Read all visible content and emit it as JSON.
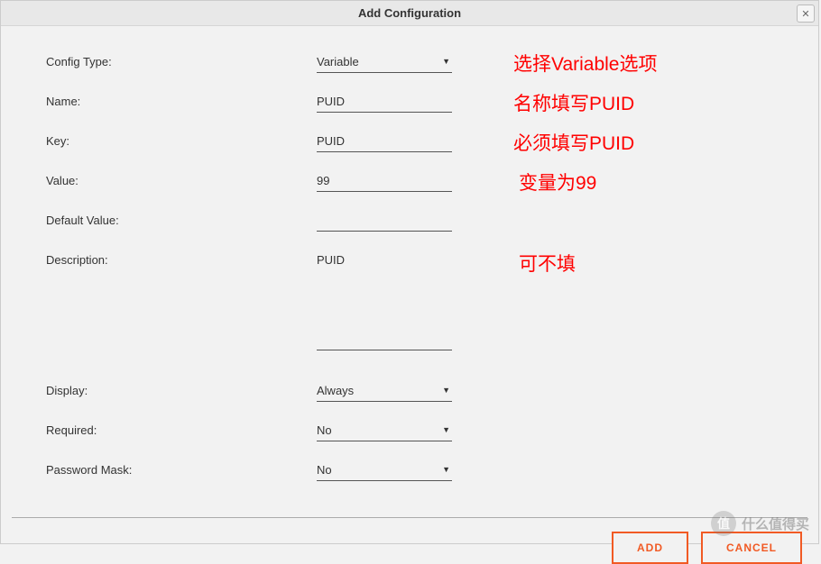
{
  "dialog": {
    "title": "Add Configuration",
    "close": "✕"
  },
  "form": {
    "configType": {
      "label": "Config Type:",
      "value": "Variable"
    },
    "name": {
      "label": "Name:",
      "value": "PUID"
    },
    "key": {
      "label": "Key:",
      "value": "PUID"
    },
    "value": {
      "label": "Value:",
      "value": "99"
    },
    "defaultValue": {
      "label": "Default Value:",
      "value": ""
    },
    "description": {
      "label": "Description:",
      "value": "PUID"
    },
    "display": {
      "label": "Display:",
      "value": "Always"
    },
    "required": {
      "label": "Required:",
      "value": "No"
    },
    "passwordMask": {
      "label": "Password Mask:",
      "value": "No"
    }
  },
  "buttons": {
    "add": "ADD",
    "cancel": "CANCEL"
  },
  "annotations": {
    "configType": "选择Variable选项",
    "name": "名称填写PUID",
    "key": "必须填写PUID",
    "value": "变量为99",
    "description": "可不填"
  },
  "watermark": {
    "icon": "值",
    "text": "什么值得买"
  }
}
